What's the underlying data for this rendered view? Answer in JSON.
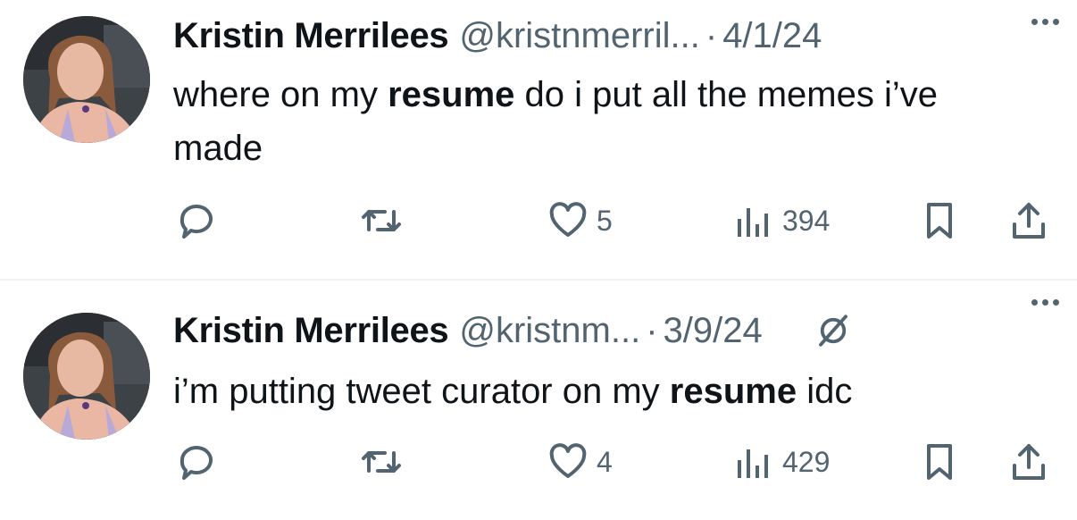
{
  "tweets": [
    {
      "author_name": "Kristin Merrilees",
      "handle": "@kristnmerril...",
      "separator": "·",
      "date": "4/1/24",
      "text_before": "where on my ",
      "text_bold": "resume",
      "text_after": " do i put all the memes i’ve made",
      "likes": "5",
      "views": "394",
      "edited": false
    },
    {
      "author_name": "Kristin Merrilees",
      "handle": "@kristnm...",
      "separator": "·",
      "date": "3/9/24",
      "text_before": "i’m putting tweet curator on my ",
      "text_bold": "resume",
      "text_after": " idc",
      "likes": "4",
      "views": "429",
      "edited": true
    }
  ],
  "icons": {
    "reply": "reply-icon",
    "retweet": "retweet-icon",
    "like": "heart-icon",
    "views": "views-icon",
    "bookmark": "bookmark-icon",
    "share": "share-icon",
    "more": "more-icon",
    "edited": "edit-history-icon"
  },
  "colors": {
    "text": "#0f1419",
    "secondary": "#536471",
    "divider": "#eff3f4"
  }
}
